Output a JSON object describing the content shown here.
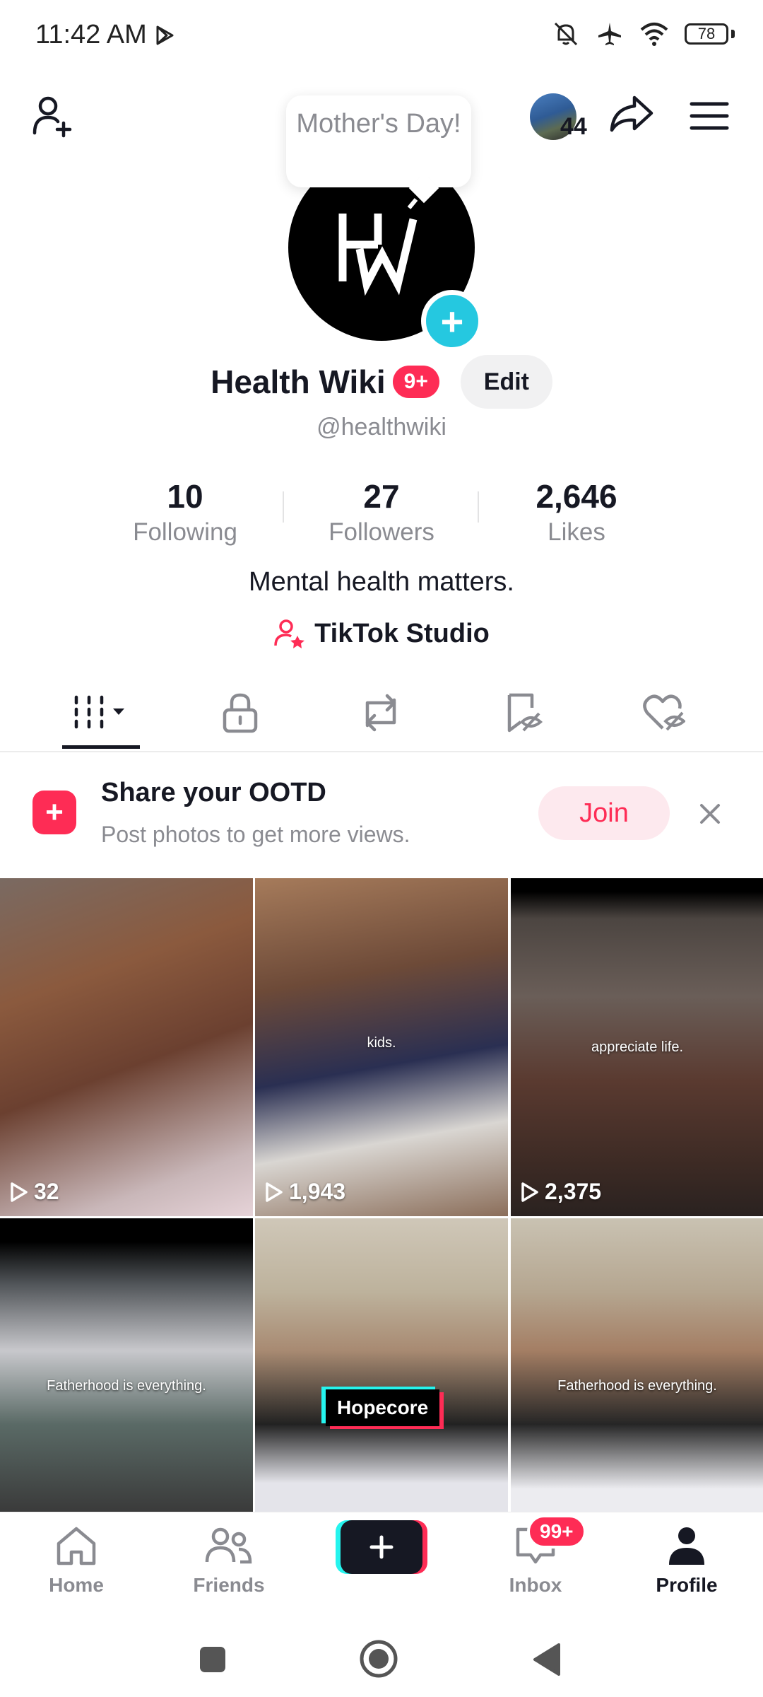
{
  "status_bar": {
    "time": "11:42 AM",
    "battery": "78"
  },
  "header": {
    "tooltip": "Mother's Day!",
    "mini_avatar_count": "44"
  },
  "profile": {
    "name": "Health Wiki",
    "notification_badge": "9+",
    "edit_label": "Edit",
    "handle": "@healthwiki",
    "stats": [
      {
        "value": "10",
        "label": "Following"
      },
      {
        "value": "27",
        "label": "Followers"
      },
      {
        "value": "2,646",
        "label": "Likes"
      }
    ],
    "bio": "Mental health matters.",
    "studio_label": "TikTok Studio"
  },
  "banner": {
    "title": "Share your OOTD",
    "subtitle": "Post photos to get more views.",
    "join_label": "Join"
  },
  "videos": [
    {
      "views": "32",
      "caption": ""
    },
    {
      "views": "1,943",
      "caption": "kids."
    },
    {
      "views": "2,375",
      "caption": "appreciate life."
    },
    {
      "views": "",
      "caption": "Fatherhood is everything."
    },
    {
      "views": "",
      "caption": "",
      "tag": "Hopecore"
    },
    {
      "views": "",
      "caption": "Fatherhood is everything."
    }
  ],
  "bottom_nav": {
    "home": "Home",
    "friends": "Friends",
    "inbox": "Inbox",
    "inbox_badge": "99+",
    "profile": "Profile"
  },
  "colors": {
    "accent": "#fe2c55",
    "cyan": "#25f4ee",
    "text": "#161823",
    "muted": "#8a8b91"
  }
}
